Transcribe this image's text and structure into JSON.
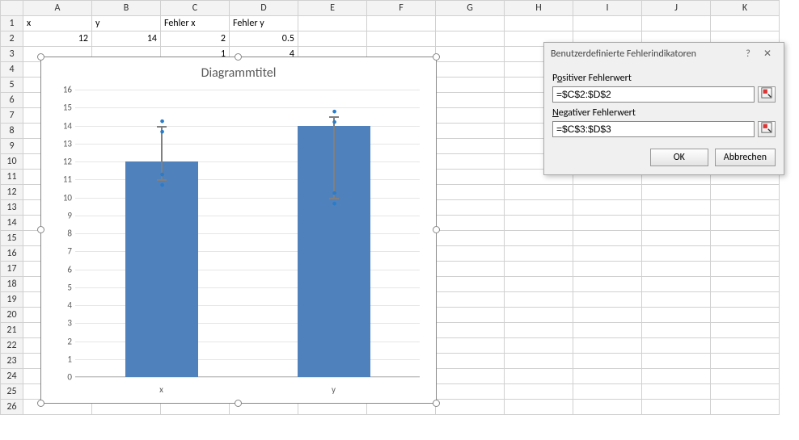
{
  "sheet": {
    "columns": [
      "A",
      "B",
      "C",
      "D",
      "E",
      "F",
      "G",
      "H",
      "I",
      "J",
      "K"
    ],
    "rows": [
      "1",
      "2",
      "3",
      "4",
      "5",
      "6",
      "7",
      "8",
      "9",
      "10",
      "11",
      "12",
      "13",
      "14",
      "15",
      "16",
      "17",
      "18",
      "19",
      "20",
      "21",
      "22",
      "23",
      "24",
      "25",
      "26"
    ],
    "cells": {
      "A1": "x",
      "B1": "y",
      "C1": "Fehler x",
      "D1": "Fehler y",
      "A2": "12",
      "B2": "14",
      "C2": "2",
      "D2": "0.5",
      "C3": "1",
      "D3": "4"
    }
  },
  "chart": {
    "title": "Diagrammtitel",
    "yticks": [
      "0",
      "1",
      "2",
      "3",
      "4",
      "5",
      "6",
      "7",
      "8",
      "9",
      "10",
      "11",
      "12",
      "13",
      "14",
      "15",
      "16"
    ],
    "categories": {
      "x": "x",
      "y": "y"
    }
  },
  "chart_data": {
    "type": "bar",
    "title": "Diagrammtitel",
    "xlabel": "",
    "ylabel": "",
    "ylim": [
      0,
      16
    ],
    "categories": [
      "x",
      "y"
    ],
    "values": [
      12,
      14
    ],
    "error": {
      "positive": [
        2,
        0.5
      ],
      "negative": [
        1,
        4
      ]
    }
  },
  "dialog": {
    "title": "Benutzerdefinierte Fehlerindikatoren",
    "pos_label_pre": "P",
    "pos_label_u": "o",
    "pos_label_post": "sitiver Fehlerwert",
    "pos_value": "=$C$2:$D$2",
    "neg_label_pre": "",
    "neg_label_u": "N",
    "neg_label_post": "egativer Fehlerwert",
    "neg_value": "=$C$3:$D$3",
    "ok": "OK",
    "cancel": "Abbrechen",
    "help": "?",
    "close": "✕"
  }
}
